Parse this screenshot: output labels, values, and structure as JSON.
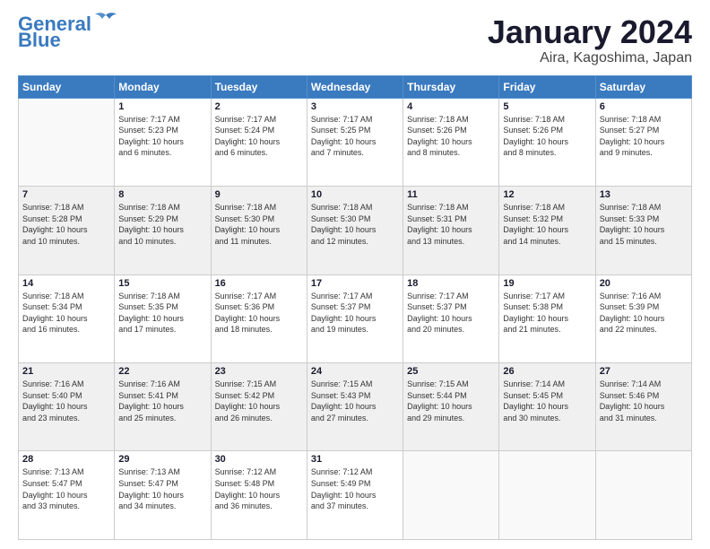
{
  "header": {
    "logo_line1": "General",
    "logo_line2": "Blue",
    "month": "January 2024",
    "location": "Aira, Kagoshima, Japan"
  },
  "weekdays": [
    "Sunday",
    "Monday",
    "Tuesday",
    "Wednesday",
    "Thursday",
    "Friday",
    "Saturday"
  ],
  "weeks": [
    [
      {
        "day": "",
        "info": ""
      },
      {
        "day": "1",
        "info": "Sunrise: 7:17 AM\nSunset: 5:23 PM\nDaylight: 10 hours\nand 6 minutes."
      },
      {
        "day": "2",
        "info": "Sunrise: 7:17 AM\nSunset: 5:24 PM\nDaylight: 10 hours\nand 6 minutes."
      },
      {
        "day": "3",
        "info": "Sunrise: 7:17 AM\nSunset: 5:25 PM\nDaylight: 10 hours\nand 7 minutes."
      },
      {
        "day": "4",
        "info": "Sunrise: 7:18 AM\nSunset: 5:26 PM\nDaylight: 10 hours\nand 8 minutes."
      },
      {
        "day": "5",
        "info": "Sunrise: 7:18 AM\nSunset: 5:26 PM\nDaylight: 10 hours\nand 8 minutes."
      },
      {
        "day": "6",
        "info": "Sunrise: 7:18 AM\nSunset: 5:27 PM\nDaylight: 10 hours\nand 9 minutes."
      }
    ],
    [
      {
        "day": "7",
        "info": "Sunrise: 7:18 AM\nSunset: 5:28 PM\nDaylight: 10 hours\nand 10 minutes."
      },
      {
        "day": "8",
        "info": "Sunrise: 7:18 AM\nSunset: 5:29 PM\nDaylight: 10 hours\nand 10 minutes."
      },
      {
        "day": "9",
        "info": "Sunrise: 7:18 AM\nSunset: 5:30 PM\nDaylight: 10 hours\nand 11 minutes."
      },
      {
        "day": "10",
        "info": "Sunrise: 7:18 AM\nSunset: 5:30 PM\nDaylight: 10 hours\nand 12 minutes."
      },
      {
        "day": "11",
        "info": "Sunrise: 7:18 AM\nSunset: 5:31 PM\nDaylight: 10 hours\nand 13 minutes."
      },
      {
        "day": "12",
        "info": "Sunrise: 7:18 AM\nSunset: 5:32 PM\nDaylight: 10 hours\nand 14 minutes."
      },
      {
        "day": "13",
        "info": "Sunrise: 7:18 AM\nSunset: 5:33 PM\nDaylight: 10 hours\nand 15 minutes."
      }
    ],
    [
      {
        "day": "14",
        "info": "Sunrise: 7:18 AM\nSunset: 5:34 PM\nDaylight: 10 hours\nand 16 minutes."
      },
      {
        "day": "15",
        "info": "Sunrise: 7:18 AM\nSunset: 5:35 PM\nDaylight: 10 hours\nand 17 minutes."
      },
      {
        "day": "16",
        "info": "Sunrise: 7:17 AM\nSunset: 5:36 PM\nDaylight: 10 hours\nand 18 minutes."
      },
      {
        "day": "17",
        "info": "Sunrise: 7:17 AM\nSunset: 5:37 PM\nDaylight: 10 hours\nand 19 minutes."
      },
      {
        "day": "18",
        "info": "Sunrise: 7:17 AM\nSunset: 5:37 PM\nDaylight: 10 hours\nand 20 minutes."
      },
      {
        "day": "19",
        "info": "Sunrise: 7:17 AM\nSunset: 5:38 PM\nDaylight: 10 hours\nand 21 minutes."
      },
      {
        "day": "20",
        "info": "Sunrise: 7:16 AM\nSunset: 5:39 PM\nDaylight: 10 hours\nand 22 minutes."
      }
    ],
    [
      {
        "day": "21",
        "info": "Sunrise: 7:16 AM\nSunset: 5:40 PM\nDaylight: 10 hours\nand 23 minutes."
      },
      {
        "day": "22",
        "info": "Sunrise: 7:16 AM\nSunset: 5:41 PM\nDaylight: 10 hours\nand 25 minutes."
      },
      {
        "day": "23",
        "info": "Sunrise: 7:15 AM\nSunset: 5:42 PM\nDaylight: 10 hours\nand 26 minutes."
      },
      {
        "day": "24",
        "info": "Sunrise: 7:15 AM\nSunset: 5:43 PM\nDaylight: 10 hours\nand 27 minutes."
      },
      {
        "day": "25",
        "info": "Sunrise: 7:15 AM\nSunset: 5:44 PM\nDaylight: 10 hours\nand 29 minutes."
      },
      {
        "day": "26",
        "info": "Sunrise: 7:14 AM\nSunset: 5:45 PM\nDaylight: 10 hours\nand 30 minutes."
      },
      {
        "day": "27",
        "info": "Sunrise: 7:14 AM\nSunset: 5:46 PM\nDaylight: 10 hours\nand 31 minutes."
      }
    ],
    [
      {
        "day": "28",
        "info": "Sunrise: 7:13 AM\nSunset: 5:47 PM\nDaylight: 10 hours\nand 33 minutes."
      },
      {
        "day": "29",
        "info": "Sunrise: 7:13 AM\nSunset: 5:47 PM\nDaylight: 10 hours\nand 34 minutes."
      },
      {
        "day": "30",
        "info": "Sunrise: 7:12 AM\nSunset: 5:48 PM\nDaylight: 10 hours\nand 36 minutes."
      },
      {
        "day": "31",
        "info": "Sunrise: 7:12 AM\nSunset: 5:49 PM\nDaylight: 10 hours\nand 37 minutes."
      },
      {
        "day": "",
        "info": ""
      },
      {
        "day": "",
        "info": ""
      },
      {
        "day": "",
        "info": ""
      }
    ]
  ]
}
